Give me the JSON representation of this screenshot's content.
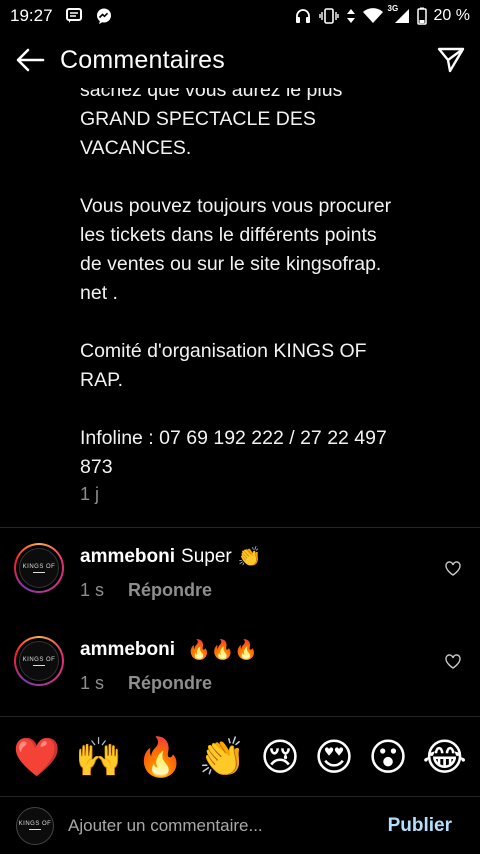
{
  "status_bar": {
    "time": "19:27",
    "left_icons": [
      "message-icon",
      "messenger-icon"
    ],
    "signal_label": "3G",
    "battery": "20 %"
  },
  "header": {
    "title": "Commentaires",
    "back_icon": "arrow-left-icon",
    "share_icon": "paper-plane-icon"
  },
  "caption": {
    "text": "sachez que vous aurez le plus\nGRAND SPECTACLE DES\nVACANCES.\n\nVous pouvez toujours vous procurer\nles tickets dans le différents points\nde ventes ou sur le site kingsofrap.\nnet .\n\nComité d'organisation KINGS OF\nRAP.\n\nInfoline : 07 69 192 222 / 27 22 497\n873",
    "time": "1 j"
  },
  "comments": [
    {
      "username": "ammeboni",
      "text": "Super",
      "emoji": "👏",
      "time": "1 s",
      "reply_label": "Répondre"
    },
    {
      "username": "ammeboni",
      "text": "",
      "emoji": "🔥🔥🔥",
      "time": "1 s",
      "reply_label": "Répondre"
    }
  ],
  "emoji_bar": [
    "❤️",
    "🙌",
    "🔥",
    "👏",
    "😢",
    "😍",
    "😮",
    "😂"
  ],
  "composer": {
    "placeholder": "Ajouter un commentaire...",
    "publish_label": "Publier"
  },
  "colors": {
    "background": "#000000",
    "muted_text": "#8e8e8e",
    "publish": "#b2dffc",
    "heart": "#ed4956"
  }
}
